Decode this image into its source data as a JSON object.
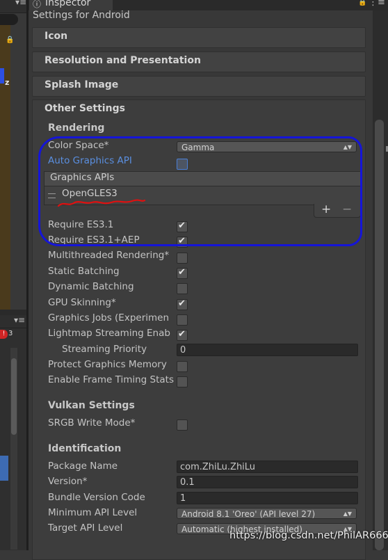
{
  "inspector": {
    "tab_title": "Inspector",
    "settings_title": "Settings for Android"
  },
  "left_panel": {
    "axis_label": "z",
    "error_badge": "!",
    "error_count": "3"
  },
  "foldouts": {
    "icon": "Icon",
    "resolution": "Resolution and Presentation",
    "splash": "Splash Image",
    "other": "Other Settings"
  },
  "rendering": {
    "header": "Rendering",
    "color_space_label": "Color Space*",
    "color_space_value": "Gamma",
    "auto_graphics_api_label": "Auto Graphics API",
    "auto_graphics_api": false,
    "graphics_apis_header": "Graphics APIs",
    "graphics_apis": [
      "OpenGLES3"
    ],
    "add_button": "+",
    "remove_button": "−",
    "require_es31_label": "Require ES3.1",
    "require_es31": true,
    "require_es31_aep_label": "Require ES3.1+AEP",
    "require_es31_aep": true,
    "multithreaded_label": "Multithreaded Rendering*",
    "multithreaded": false,
    "static_batching_label": "Static Batching",
    "static_batching": true,
    "dynamic_batching_label": "Dynamic Batching",
    "dynamic_batching": false,
    "gpu_skinning_label": "GPU Skinning*",
    "gpu_skinning": true,
    "graphics_jobs_label": "Graphics Jobs (Experimen",
    "graphics_jobs": false,
    "lightmap_streaming_label": "Lightmap Streaming Enab",
    "lightmap_streaming": true,
    "streaming_priority_label": "Streaming Priority",
    "streaming_priority_value": "0",
    "protect_memory_label": "Protect Graphics Memory",
    "protect_memory": false,
    "frame_timing_label": "Enable Frame Timing Stats",
    "frame_timing": false
  },
  "vulkan": {
    "header": "Vulkan Settings",
    "srgb_label": "SRGB Write Mode*",
    "srgb": false
  },
  "identification": {
    "header": "Identification",
    "package_name_label": "Package Name",
    "package_name_value": "com.ZhiLu.ZhiLu",
    "version_label": "Version*",
    "version_value": "0.1",
    "bundle_code_label": "Bundle Version Code",
    "bundle_code_value": "1",
    "min_api_label": "Minimum API Level",
    "min_api_value": "Android 8.1 'Oreo' (API level 27)",
    "target_api_label": "Target API Level",
    "target_api_value": "Automatic (highest installed)"
  },
  "watermark": "https://blog.csdn.net/PhilAR666",
  "colors": {
    "annotation_blue": "#1515d8",
    "annotation_red": "#e01010",
    "link_blue": "#5a8fe0"
  }
}
